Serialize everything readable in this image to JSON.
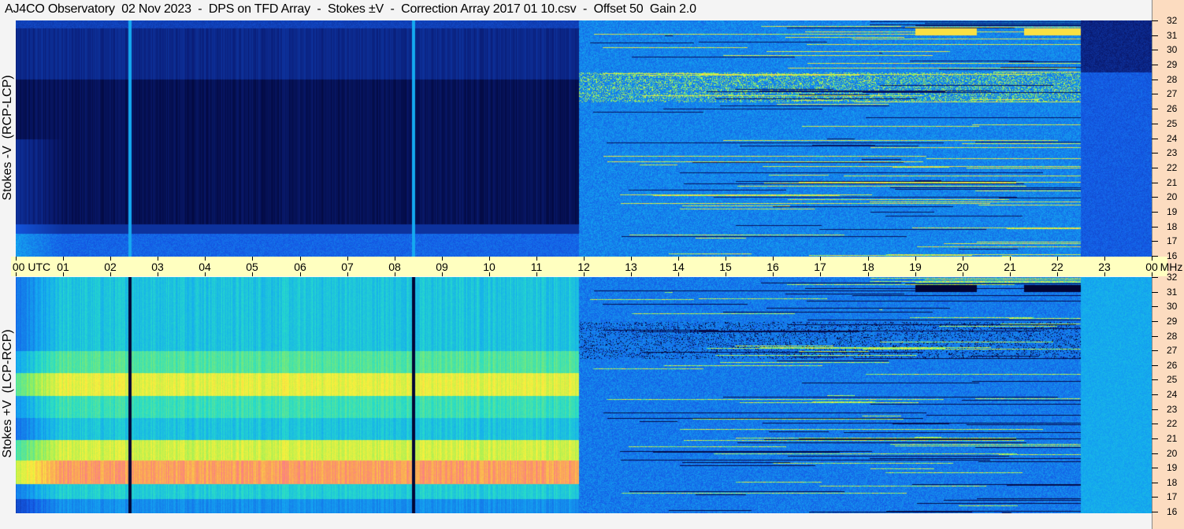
{
  "title": "AJ4CO Observatory  02 Nov 2023  -  DPS on TFD Array  -  Stokes ±V  -  Correction Array 2017 01 10.csv  -  Offset 50  Gain 2.0",
  "panels": [
    {
      "id": "top",
      "label": "Stokes -V  (RCP-LCP)"
    },
    {
      "id": "bottom",
      "label": "Stokes +V  (LCP-RCP)"
    }
  ],
  "time_axis": {
    "labels": [
      "00 UTC",
      "01",
      "02",
      "03",
      "04",
      "05",
      "06",
      "07",
      "08",
      "09",
      "10",
      "11",
      "12",
      "13",
      "14",
      "15",
      "16",
      "17",
      "18",
      "19",
      "20",
      "21",
      "22",
      "23",
      "00"
    ],
    "unit": "MHz"
  },
  "freq_axis": {
    "labels": [
      "32",
      "31",
      "30",
      "29",
      "28",
      "27",
      "26",
      "25",
      "24",
      "23",
      "22",
      "21",
      "20",
      "19",
      "18",
      "17",
      "16"
    ]
  },
  "colors": {
    "axis_band": "#ffffc0",
    "right_panel": "#fcdcc0"
  }
}
